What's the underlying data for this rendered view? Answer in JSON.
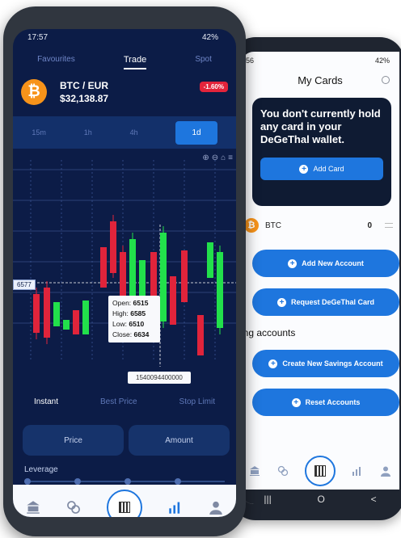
{
  "front_phone": {
    "status_time": "17:57",
    "battery": "42%",
    "tabs": [
      "Favourites",
      "Trade",
      "Spot"
    ],
    "pair": "BTC / EUR",
    "price": "$32,138.87",
    "change": "-1.60%",
    "timeframes": [
      "15m",
      "1h",
      "4h",
      "1d"
    ],
    "price_tag": "6577",
    "tooltip": {
      "open_label": "Open:",
      "open": "6515",
      "high_label": "High:",
      "high": "6585",
      "low_label": "Low:",
      "low": "6510",
      "close_label": "Close:",
      "close": "6634"
    },
    "timestamp": "1540094400000",
    "order_tabs": [
      "Instant",
      "Best Price",
      "Stop Limit"
    ],
    "price_placeholder": "Price",
    "amount_placeholder": "Amount",
    "leverage": "Leverage",
    "nav": [
      "|||",
      "O",
      "<",
      "↓"
    ]
  },
  "back_phone": {
    "status_time": "56",
    "battery": "42%",
    "title": "My Cards",
    "no_card_message": "You don't currently hold any card in your DeGeThal wallet.",
    "add_card": "Add Card",
    "btc_label": "BTC",
    "btc_balance": "0",
    "add_account": "Add New Account",
    "request_card": "Request DeGeThal Card",
    "savings_heading": "ing accounts",
    "create_savings": "Create New Savings Account",
    "reset_accounts": "Reset Accounts",
    "nav": [
      "|||",
      "O",
      "<"
    ]
  },
  "colors": {
    "accent": "#1e76de",
    "bull": "#22e04b",
    "bear": "#e0243b",
    "navy": "#0c1c47"
  }
}
